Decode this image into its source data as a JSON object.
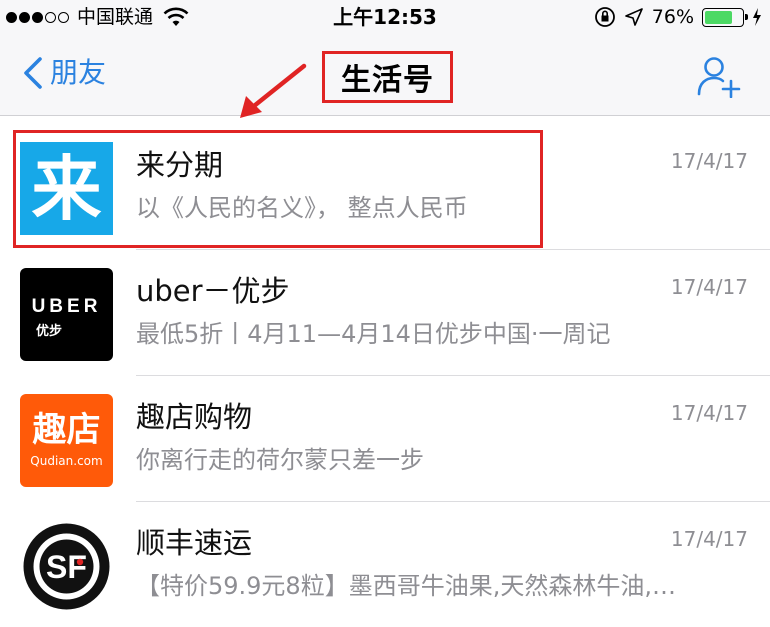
{
  "status_bar": {
    "carrier": "中国联通",
    "time": "上午12:53",
    "battery_percent": "76%",
    "battery_level": 0.76,
    "signal_dots_filled": 3,
    "signal_dots_total": 5
  },
  "nav": {
    "back_label": "朋友",
    "title": "生活号"
  },
  "colors": {
    "accent": "#2b82e0",
    "annotation": "#e02424",
    "battery": "#4cd964"
  },
  "items": [
    {
      "title": "来分期",
      "subtitle": "以《人民的名义》， 整点人民币",
      "date": "17/4/17",
      "avatar_glyph": "来"
    },
    {
      "title": "uber－优步",
      "subtitle": "最低5折丨4月11—4月14日优步中国·一周记",
      "date": "17/4/17",
      "avatar_word": "UBER",
      "avatar_cn": "优步"
    },
    {
      "title": "趣店购物",
      "subtitle": "你离行走的荷尔蒙只差一步",
      "date": "17/4/17",
      "avatar_cn": "趣店",
      "avatar_en": "Qudian.com"
    },
    {
      "title": "顺丰速运",
      "subtitle": "【特价59.9元8粒】墨西哥牛油果,天然森林牛油,…",
      "date": "17/4/17",
      "avatar_letters": "SF"
    }
  ]
}
